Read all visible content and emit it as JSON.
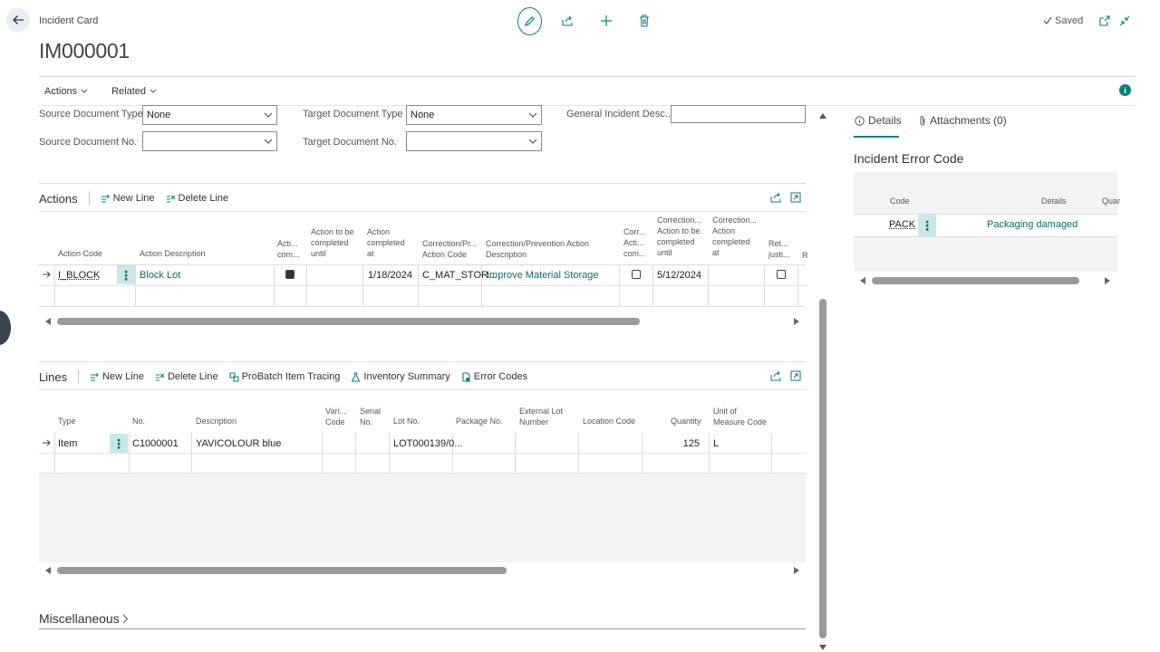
{
  "header": {
    "caption": "Incident Card",
    "title": "IM000001",
    "saved": "Saved"
  },
  "actionbar": {
    "actions": "Actions",
    "related": "Related"
  },
  "fields": {
    "source_doc_type_label": "Source Document Type",
    "source_doc_type_value": "None",
    "source_doc_no_label": "Source Document No.",
    "source_doc_no_value": "",
    "target_doc_type_label": "Target Document Type",
    "target_doc_type_value": "None",
    "target_doc_no_label": "Target Document No.",
    "target_doc_no_value": "",
    "general_desc_label": "General Incident Desc...",
    "general_desc_value": ""
  },
  "actions_part": {
    "title": "Actions",
    "new_line": "New Line",
    "delete_line": "Delete Line",
    "columns": {
      "action_code": "Action Code",
      "action_description": "Action Description",
      "action_completed": [
        "Acti...",
        "com..."
      ],
      "action_to_be_completed_until": [
        "Action to be",
        "completed",
        "until"
      ],
      "action_completed_at": [
        "Action",
        "completed",
        "at"
      ],
      "correction_action_code": [
        "Correction/Pr...",
        "Action Code"
      ],
      "correction_action_description": [
        "Correction/Prevention Action",
        "Description"
      ],
      "corr_action_completed": [
        "Corr...",
        "Acti...",
        "com..."
      ],
      "correction_to_be_completed_until": [
        "Correction...",
        "Action to be",
        "completed",
        "until"
      ],
      "correction_completed_at": [
        "Correction...",
        "Action",
        "completed",
        "at"
      ],
      "ret_justification": [
        "Ret...",
        "justi..."
      ],
      "r": "R"
    },
    "row": {
      "action_code": "I_BLOCK",
      "action_description": "Block Lot",
      "action_completed_at": "1/18/2024",
      "correction_action_code": "C_MAT_STOR...",
      "correction_action_description": "Improve Material Storage",
      "correction_to_be_completed_until": "5/12/2024"
    }
  },
  "lines_part": {
    "title": "Lines",
    "new_line": "New Line",
    "delete_line": "Delete Line",
    "probatch": "ProBatch Item Tracing",
    "inventory_summary": "Inventory Summary",
    "error_codes": "Error Codes",
    "columns": {
      "type": "Type",
      "no": "No.",
      "description": "Description",
      "variant_code": [
        "Vari...",
        "Code"
      ],
      "serial_no": [
        "Serial",
        "No."
      ],
      "lot_no": "Lot No.",
      "package_no": "Package No.",
      "external_lot_number": [
        "External Lot",
        "Number"
      ],
      "location_code": "Location Code",
      "quantity": "Quantity",
      "unit_of_measure_code": [
        "Unit of",
        "Measure Code"
      ]
    },
    "row": {
      "type": "Item",
      "no": "C1000001",
      "description": "YAVICOLOUR blue",
      "lot_no": "LOT000139/0...",
      "quantity": "125",
      "unit_of_measure": "L"
    }
  },
  "misc": {
    "title": "Miscellaneous"
  },
  "factbox": {
    "tab_details": "Details",
    "tab_attachments": "Attachments (0)",
    "title": "Incident Error Code",
    "col_code": "Code",
    "col_details": "Details",
    "col_qua": "Quar",
    "row_code": "PACK",
    "row_details": "Packaging damaged"
  },
  "colors": {
    "accent": "#0a7f80",
    "link": "#0a6b6c",
    "row_handle": "#c9e7e7"
  }
}
